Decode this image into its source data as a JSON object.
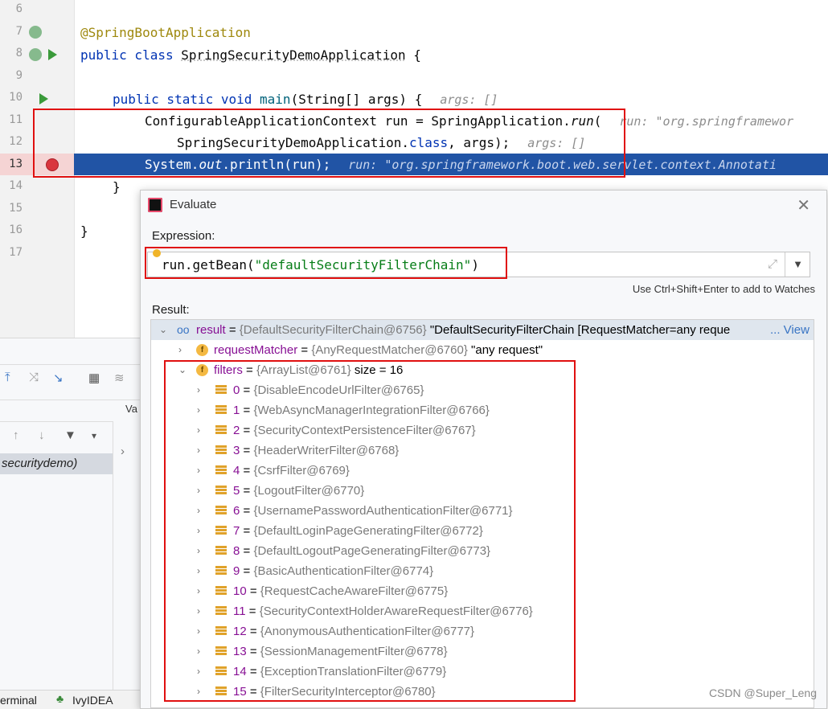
{
  "editor": {
    "line_numbers": [
      "6",
      "7",
      "8",
      "9",
      "10",
      "11",
      "12",
      "13",
      "14",
      "15",
      "16",
      "17"
    ],
    "lines": {
      "l7": "@SpringBootApplication",
      "l8_kw": "public class ",
      "l8_name": "SpringSecurityDemoApplication",
      "l8_rest": " {",
      "l10_kw": "public static void ",
      "l10_fn": "main",
      "l10_rest": "(String[] args) {",
      "l10_hint": "args: []",
      "l11_a": "ConfigurableApplicationContext run = SpringApplication.",
      "l11_b": "run",
      "l11_c": "(",
      "l11_hint": "run: \"org.springframewor",
      "l12_a": "SpringSecurityDemoApplication.",
      "l12_kw": "class",
      "l12_b": ", args);",
      "l12_hint": "args: []",
      "l13_a": "System.",
      "l13_out": "out",
      "l13_b": ".println(run);",
      "l13_hint": "run: \"org.springframework.boot.web.servlet.context.Annotati",
      "l14": "}",
      "l16": "}"
    }
  },
  "side_panel": {
    "col_label": "Va",
    "frame": "securitydemo)",
    "bottom_tabs": [
      "erminal",
      "IvyIDEA"
    ]
  },
  "dialog": {
    "title": "Evaluate",
    "expression_label": "Expression:",
    "expression_plain": "run.getBean(",
    "expression_string": "\"defaultSecurityFilterChain\"",
    "expression_end": ")",
    "hint": "Use Ctrl+Shift+Enter to add to Watches",
    "result_label": "Result:",
    "result": {
      "name": "result",
      "type": "{DefaultSecurityFilterChain@6756}",
      "value": "\"DefaultSecurityFilterChain [RequestMatcher=any reque",
      "view_link": "... View"
    },
    "request_matcher": {
      "name": "requestMatcher",
      "type": "{AnyRequestMatcher@6760}",
      "value": "\"any request\""
    },
    "filters": {
      "name": "filters",
      "type": "{ArrayList@6761}",
      "size": "size = 16"
    },
    "items": [
      {
        "i": "0",
        "v": "{DisableEncodeUrlFilter@6765}"
      },
      {
        "i": "1",
        "v": "{WebAsyncManagerIntegrationFilter@6766}"
      },
      {
        "i": "2",
        "v": "{SecurityContextPersistenceFilter@6767}"
      },
      {
        "i": "3",
        "v": "{HeaderWriterFilter@6768}"
      },
      {
        "i": "4",
        "v": "{CsrfFilter@6769}"
      },
      {
        "i": "5",
        "v": "{LogoutFilter@6770}"
      },
      {
        "i": "6",
        "v": "{UsernamePasswordAuthenticationFilter@6771}"
      },
      {
        "i": "7",
        "v": "{DefaultLoginPageGeneratingFilter@6772}"
      },
      {
        "i": "8",
        "v": "{DefaultLogoutPageGeneratingFilter@6773}"
      },
      {
        "i": "9",
        "v": "{BasicAuthenticationFilter@6774}"
      },
      {
        "i": "10",
        "v": "{RequestCacheAwareFilter@6775}"
      },
      {
        "i": "11",
        "v": "{SecurityContextHolderAwareRequestFilter@6776}"
      },
      {
        "i": "12",
        "v": "{AnonymousAuthenticationFilter@6777}"
      },
      {
        "i": "13",
        "v": "{SessionManagementFilter@6778}"
      },
      {
        "i": "14",
        "v": "{ExceptionTranslationFilter@6779}"
      },
      {
        "i": "15",
        "v": "{FilterSecurityInterceptor@6780}"
      }
    ]
  },
  "watermark": "CSDN @Super_Leng"
}
